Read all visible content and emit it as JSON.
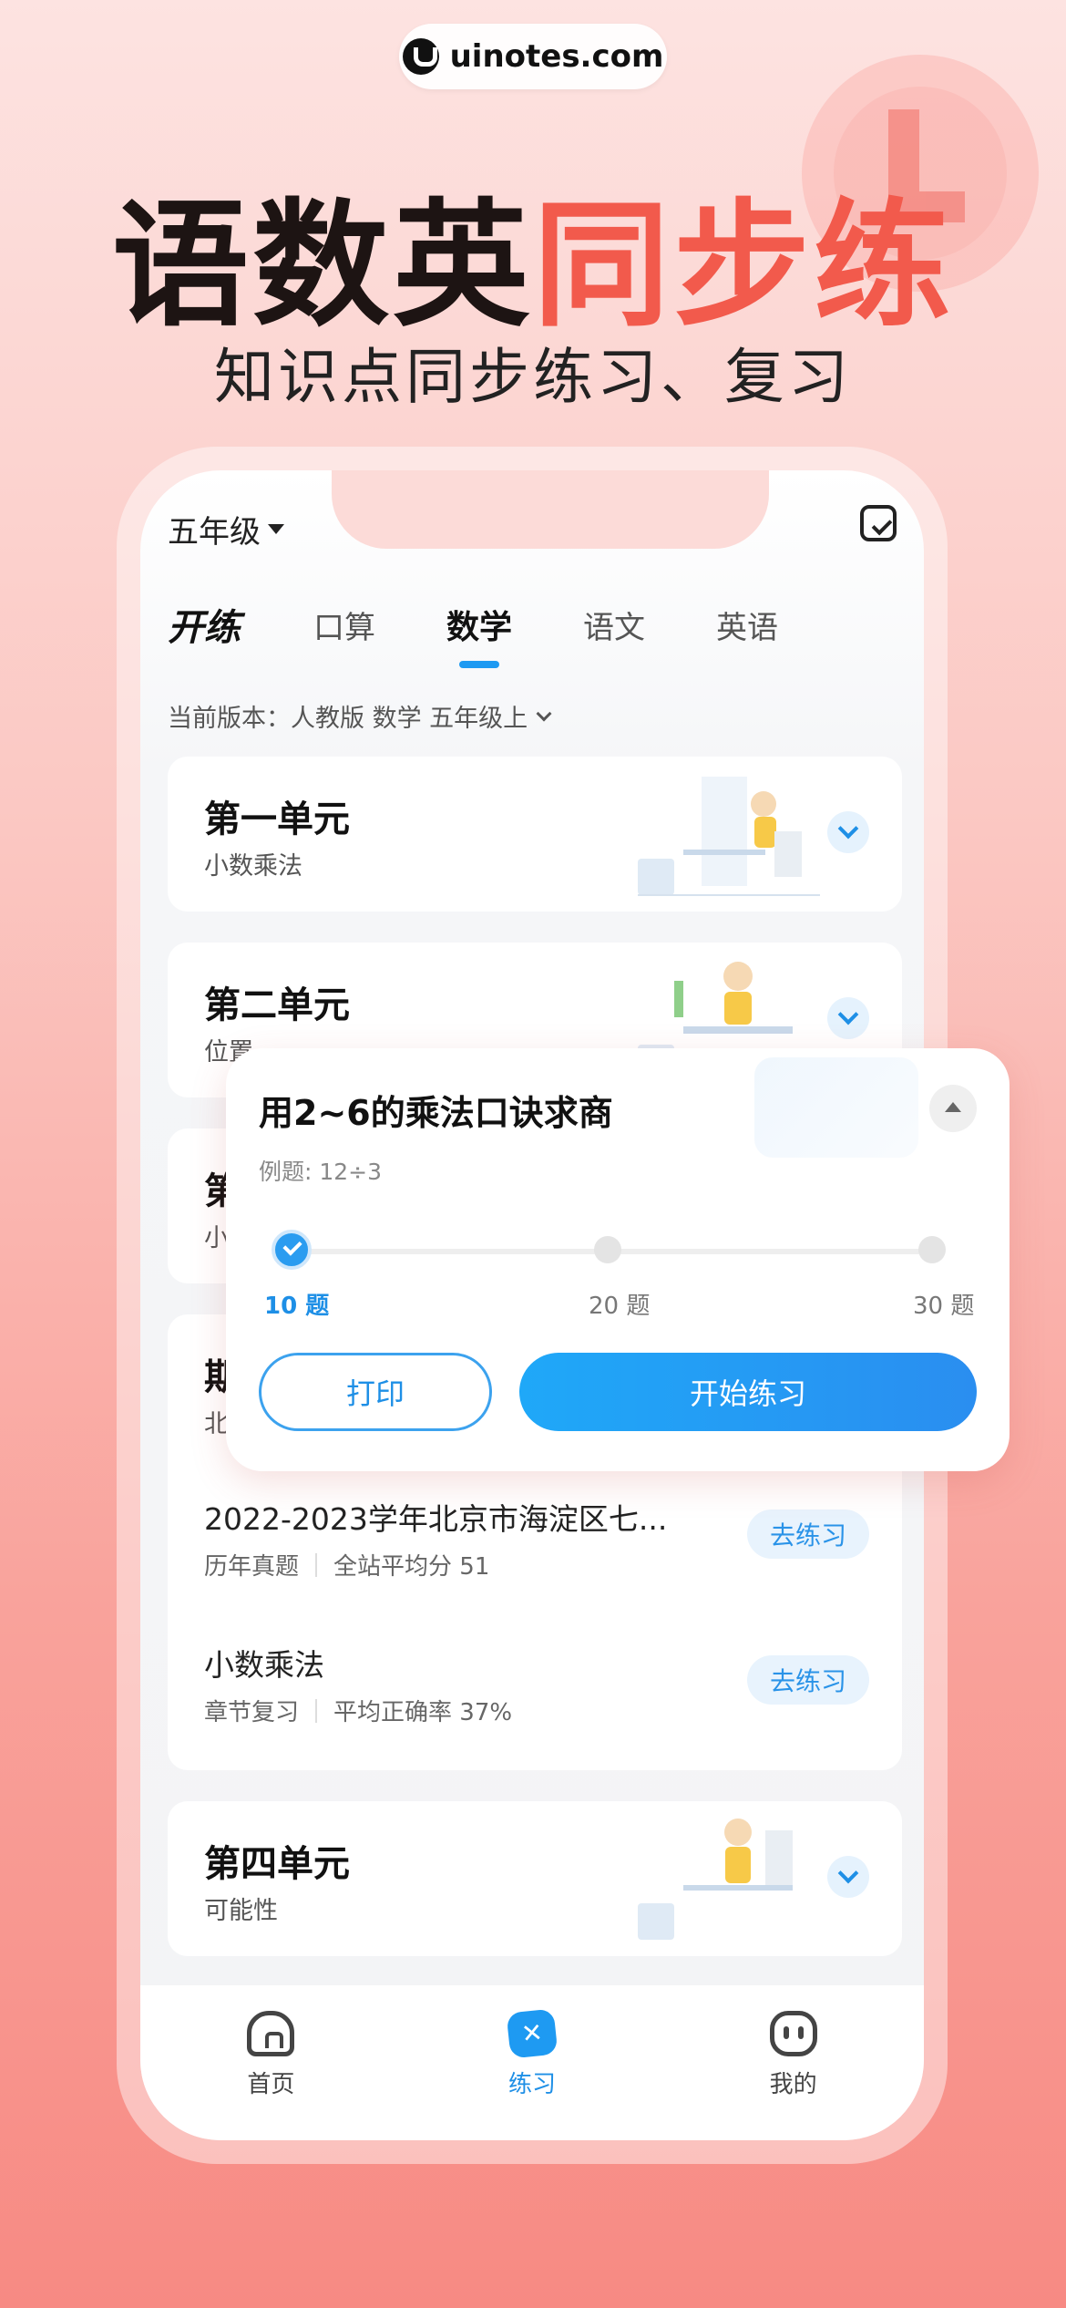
{
  "watermark": "uinotes.com",
  "hero": {
    "title_part1": "语数英",
    "title_part2": "同步练",
    "subtitle": "知识点同步练习、复习"
  },
  "header": {
    "grade": "五年级",
    "tabs": [
      {
        "label": "开练",
        "type": "logo"
      },
      {
        "label": "口算"
      },
      {
        "label": "数学",
        "active": true
      },
      {
        "label": "语文"
      },
      {
        "label": "英语"
      }
    ],
    "version": "当前版本：人教版 数学 五年级上"
  },
  "units": [
    {
      "title": "第一单元",
      "subtitle": "小数乘法"
    },
    {
      "title": "第二单元",
      "subtitle": "位置"
    },
    {
      "title": "第",
      "subtitle": "小"
    },
    {
      "title": "期",
      "subtitle": "北"
    }
  ],
  "practice_list": [
    {
      "title": "2022-2023学年北京市海淀区七...",
      "meta1": "历年真题",
      "meta2": "全站平均分 51",
      "button": "去练习"
    },
    {
      "title": "小数乘法",
      "meta1": "章节复习",
      "meta2": "平均正确率 37%",
      "button": "去练习"
    }
  ],
  "unit4": {
    "title": "第四单元",
    "subtitle": "可能性"
  },
  "bottom_nav": [
    {
      "label": "首页",
      "icon": "home-icon"
    },
    {
      "label": "练习",
      "icon": "practice-icon",
      "active": true
    },
    {
      "label": "我的",
      "icon": "me-icon"
    }
  ],
  "popup": {
    "title": "用2~6的乘法口诀求商",
    "example": "例题: 12÷3",
    "options": [
      "10 题",
      "20 题",
      "30 题"
    ],
    "selected_index": 0,
    "print_label": "打印",
    "start_label": "开始练习"
  },
  "colors": {
    "accent": "#1e9af2",
    "title_red": "#f25a4c"
  }
}
